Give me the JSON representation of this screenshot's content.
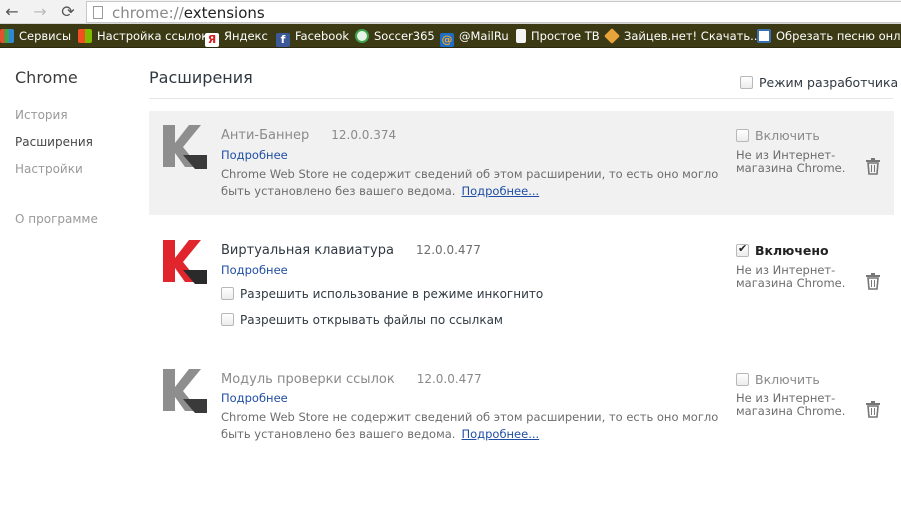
{
  "toolbar": {
    "back_icon": "←",
    "forward_icon": "→",
    "reload_icon": "⟳",
    "url_scheme": "chrome://",
    "url_path": "extensions"
  },
  "bookmarks": [
    {
      "label": "Сервисы",
      "icon_color": "#e0522f"
    },
    {
      "label": "Настройка ссылок",
      "icon_color": "#2f87d8"
    },
    {
      "label": "Яндекс",
      "icon_color": "#d42020"
    },
    {
      "label": "Facebook",
      "icon_color": "#3b5998"
    },
    {
      "label": "Soccer365",
      "icon_color": "#3ea34a"
    },
    {
      "label": "@MailRu",
      "icon_color": "#1e6ec8"
    },
    {
      "label": "Простое ТВ",
      "icon_color": "#dddddd"
    },
    {
      "label": "Зайцев.нет! Скачать...",
      "icon_color": "#e8a43a"
    },
    {
      "label": "Обрезать песню онл...",
      "icon_color": "#3a6fb0"
    }
  ],
  "sidebar": {
    "title": "Chrome",
    "items": [
      {
        "label": "История"
      },
      {
        "label": "Расширения"
      },
      {
        "label": "Настройки"
      }
    ],
    "about": "О программе"
  },
  "main": {
    "title": "Расширения",
    "dev_mode_label": "Режим разработчика"
  },
  "extensions": [
    {
      "name": "Анти-Баннер",
      "version": "12.0.0.374",
      "details": "Подробнее",
      "enabled": false,
      "enable_label": "Включить",
      "warning_text": "Chrome Web Store не содержит сведений об этом расширении, то есть оно могло быть установлено без вашего ведома.",
      "warning_link": "Подробнее...",
      "source": "Не из Интернет-магазина Chrome."
    },
    {
      "name": "Виртуальная клавиатура",
      "version": "12.0.0.477",
      "details": "Подробнее",
      "enabled": true,
      "enable_label": "Включено",
      "option1": "Разрешить использование в режиме инкогнито",
      "option2": "Разрешить открывать файлы по ссылкам",
      "source": "Не из Интернет-магазина Chrome."
    },
    {
      "name": "Модуль проверки ссылок",
      "version": "12.0.0.477",
      "details": "Подробнее",
      "enabled": false,
      "enable_label": "Включить",
      "warning_text": "Chrome Web Store не содержит сведений об этом расширении, то есть оно могло быть установлено без вашего ведома.",
      "warning_link": "Подробнее...",
      "source": "Не из Интернет-магазина Chrome."
    }
  ],
  "colors": {
    "kaspersky_red": "#e0262c",
    "kaspersky_gray": "#8e8e8e",
    "link_blue": "#1f4ea3",
    "bookmark_bar": "#3b3a14"
  }
}
